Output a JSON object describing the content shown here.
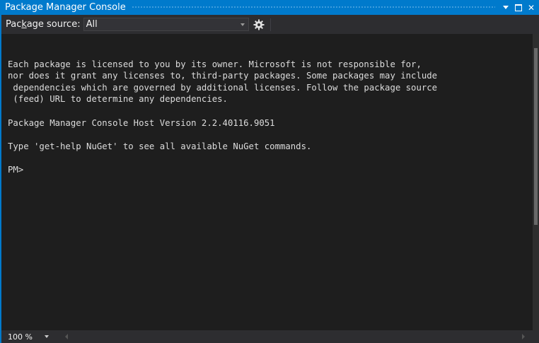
{
  "window": {
    "title": "Package Manager Console",
    "title_icons": [
      "dropdown-arrow-icon",
      "maximize-icon",
      "close-icon"
    ]
  },
  "toolbar": {
    "source_label_pre": "Pac",
    "source_label_accel": "k",
    "source_label_post": "age source:",
    "source_value": "All",
    "settings_icon": "gear-icon"
  },
  "console": {
    "license_lines": [
      "Each package is licensed to you by its owner. Microsoft is not responsible for,",
      "nor does it grant any licenses to, third-party packages. Some packages may include",
      " dependencies which are governed by additional licenses. Follow the package source",
      " (feed) URL to determine any dependencies."
    ],
    "version_line": "Package Manager Console Host Version 2.2.40116.9051",
    "help_line": "Type 'get-help NuGet' to see all available NuGet commands.",
    "prompt": "PM>"
  },
  "status": {
    "zoom": "100 %"
  },
  "colors": {
    "accent": "#007acc",
    "background": "#1e1e1e",
    "toolbar": "#2d2d30",
    "text": "#dcdcdc"
  }
}
